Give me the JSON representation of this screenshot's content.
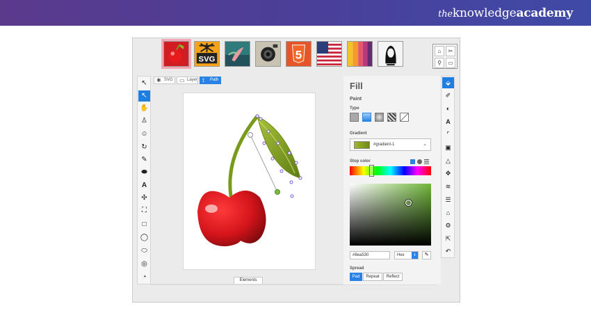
{
  "brand": {
    "prefix": "the",
    "middle": "knowledge",
    "bold": "academy"
  },
  "thumbnails": [
    {
      "name": "cherry",
      "selected": true
    },
    {
      "name": "svg-logo",
      "label": "SVG",
      "selected": false
    },
    {
      "name": "flower-photo",
      "selected": false
    },
    {
      "name": "camera",
      "selected": false
    },
    {
      "name": "html5-logo",
      "label": "5",
      "selected": false
    },
    {
      "name": "us-flag",
      "selected": false
    },
    {
      "name": "color-stripes",
      "selected": false
    },
    {
      "name": "portrait",
      "selected": false
    }
  ],
  "minitools": [
    "⌂",
    "✂",
    "⚲",
    "▭"
  ],
  "left_tools": [
    {
      "name": "pointer",
      "glyph": "↖",
      "selected": false
    },
    {
      "name": "select",
      "glyph": "↖",
      "selected": true
    },
    {
      "name": "pan",
      "glyph": "✋",
      "selected": false
    },
    {
      "name": "person",
      "glyph": "♙",
      "selected": false
    },
    {
      "name": "face",
      "glyph": "☺",
      "selected": false
    },
    {
      "name": "rotate",
      "glyph": "↻",
      "selected": false
    },
    {
      "name": "pencil",
      "glyph": "✎",
      "selected": false
    },
    {
      "name": "ellipse-fill",
      "glyph": "⬬",
      "selected": false
    },
    {
      "name": "text",
      "glyph": "A",
      "selected": false
    },
    {
      "name": "node",
      "glyph": "✣",
      "selected": false
    },
    {
      "name": "fullscreen",
      "glyph": "⛶",
      "selected": false
    },
    {
      "name": "rect",
      "glyph": "□",
      "selected": false
    },
    {
      "name": "circle",
      "glyph": "◯",
      "selected": false
    },
    {
      "name": "ellipse",
      "glyph": "⬭",
      "selected": false
    },
    {
      "name": "target",
      "glyph": "◎",
      "selected": false
    },
    {
      "name": "pie",
      "glyph": "◔",
      "selected": false
    }
  ],
  "modes": [
    {
      "name": "svg",
      "icon": "✱",
      "label": "SVG",
      "active": false
    },
    {
      "name": "layer",
      "icon": "▭",
      "label": "Layer",
      "active": false
    },
    {
      "name": "path",
      "icon": "⟟",
      "label": "Path",
      "active": true
    }
  ],
  "elements_tab": "Elements",
  "panel": {
    "title": "Fill",
    "paint": "Paint",
    "type_label": "Type",
    "gradient_label": "Gradient",
    "gradient_name": "#gradient-1",
    "stop_color_label": "Stop color",
    "hex_value": "#8ea530",
    "format": "Hex",
    "spread_label": "Spread",
    "spread_options": [
      {
        "label": "Pad",
        "active": true
      },
      {
        "label": "Repeat",
        "active": false
      },
      {
        "label": "Reflect",
        "active": false
      }
    ]
  },
  "right_tools": [
    {
      "name": "fill",
      "glyph": "⬙",
      "selected": true
    },
    {
      "name": "brush",
      "glyph": "✐",
      "selected": false
    },
    {
      "name": "contrast",
      "glyph": "◐",
      "selected": false
    },
    {
      "name": "font",
      "glyph": "A",
      "selected": false
    },
    {
      "name": "corner",
      "glyph": "⌜",
      "selected": false
    },
    {
      "name": "comment",
      "glyph": "▣",
      "selected": false
    },
    {
      "name": "triangle",
      "glyph": "△",
      "selected": false
    },
    {
      "name": "move",
      "glyph": "✥",
      "selected": false
    },
    {
      "name": "layers",
      "glyph": "≋",
      "selected": false
    },
    {
      "name": "list",
      "glyph": "☰",
      "selected": false
    },
    {
      "name": "building",
      "glyph": "⌂",
      "selected": false
    },
    {
      "name": "settings",
      "glyph": "⚙",
      "selected": false
    },
    {
      "name": "export",
      "glyph": "⇱",
      "selected": false
    },
    {
      "name": "undo",
      "glyph": "↶",
      "selected": false
    }
  ],
  "colors": {
    "accent": "#2a82e4",
    "cherry": "#d4141b",
    "leaf": "#8ea530"
  }
}
